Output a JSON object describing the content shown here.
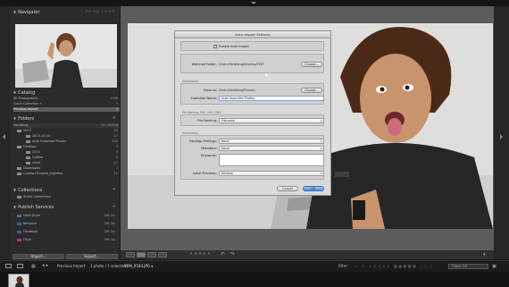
{
  "navigator": {
    "title": "Navigator",
    "modes": "FIT  FILL  1:1  3:1"
  },
  "catalog": {
    "title": "Catalog",
    "items": [
      {
        "label": "All Photographs",
        "count": "1786"
      },
      {
        "label": "Quick Collection +",
        "count": "0"
      },
      {
        "label": "Previous Import",
        "count": "1"
      }
    ]
  },
  "folders": {
    "title": "Folders",
    "volume": {
      "label": "VonWong",
      "info": "30 / 149GB"
    },
    "items": [
      {
        "label": "2013",
        "count": "26"
      },
      {
        "label": "2013-10-30",
        "count": "27"
      },
      {
        "label": "Auto Imported Photos",
        "count": "100"
      },
      {
        "label": "Desktop",
        "count": "3"
      },
      {
        "label": "2013",
        "count": "3"
      },
      {
        "label": "FullRes",
        "count": "0"
      },
      {
        "label": "small",
        "count": "12"
      },
      {
        "label": "Downloads",
        "count": "2"
      },
      {
        "label": "ComfortThrones_HighRes",
        "count": "10"
      }
    ]
  },
  "collections": {
    "title": "Collections",
    "items": [
      {
        "label": "Smart Collections",
        "count": ""
      }
    ]
  },
  "publish": {
    "title": "Publish Services",
    "items": [
      {
        "label": "Hard Drive",
        "count": "Set Up..."
      },
      {
        "label": "Behance",
        "count": "Set Up..."
      },
      {
        "label": "Facebook",
        "count": "Set Up..."
      },
      {
        "label": "Flickr",
        "count": "Set Up..."
      }
    ]
  },
  "buttons": {
    "import": "Import...",
    "export": "Export..."
  },
  "dialog": {
    "title": "Auto Import Settings",
    "enable_label": "Enable Auto Import",
    "enable_checked": "✓",
    "watched_label": "Watched Folder:",
    "watched_path": "/Users/VonWong/Desktop/TEST",
    "choose_label": "Choose...",
    "destination_section": "Destination",
    "move_to_label": "Move to:",
    "move_to_path": "/Users/VonWong/Pictures",
    "choose_label_2": "Choose...",
    "subfolder_label": "Subfolder Name:",
    "subfolder_value": "Auto Imported Photos",
    "file_naming_section": "File Naming:  IMG_0001.DNG",
    "file_naming_label": "File Naming:",
    "file_naming_value": "Filename",
    "information_section": "Information",
    "develop_label": "Develop Settings:",
    "develop_value": "None",
    "metadata_label": "Metadata:",
    "metadata_value": "None",
    "keywords_label": "Keywords:",
    "keywords_value": "",
    "previews_label": "Initial Previews:",
    "previews_value": "Minimal",
    "cancel_label": "Cancel",
    "ok_label": "OK"
  },
  "filmstrip": {
    "source": "Previous Import",
    "selection": "1 photo / 1 selected /",
    "filename": "VON_9184.JPG ▾",
    "filter_label": "Filter:",
    "filter_value": "Filters Off"
  },
  "colors": {
    "panel_bg": "#2b2b2b",
    "selected_row": "#5d5d5d",
    "dialog_bg": "#dadada",
    "ok_button": "#4c8ee2"
  },
  "icons": [
    "navigator-thumbnail",
    "grid-view-icon",
    "loupe-view-icon",
    "compare-view-icon",
    "survey-view-icon",
    "rotate-left-icon",
    "rotate-right-icon",
    "monitor-icon"
  ]
}
